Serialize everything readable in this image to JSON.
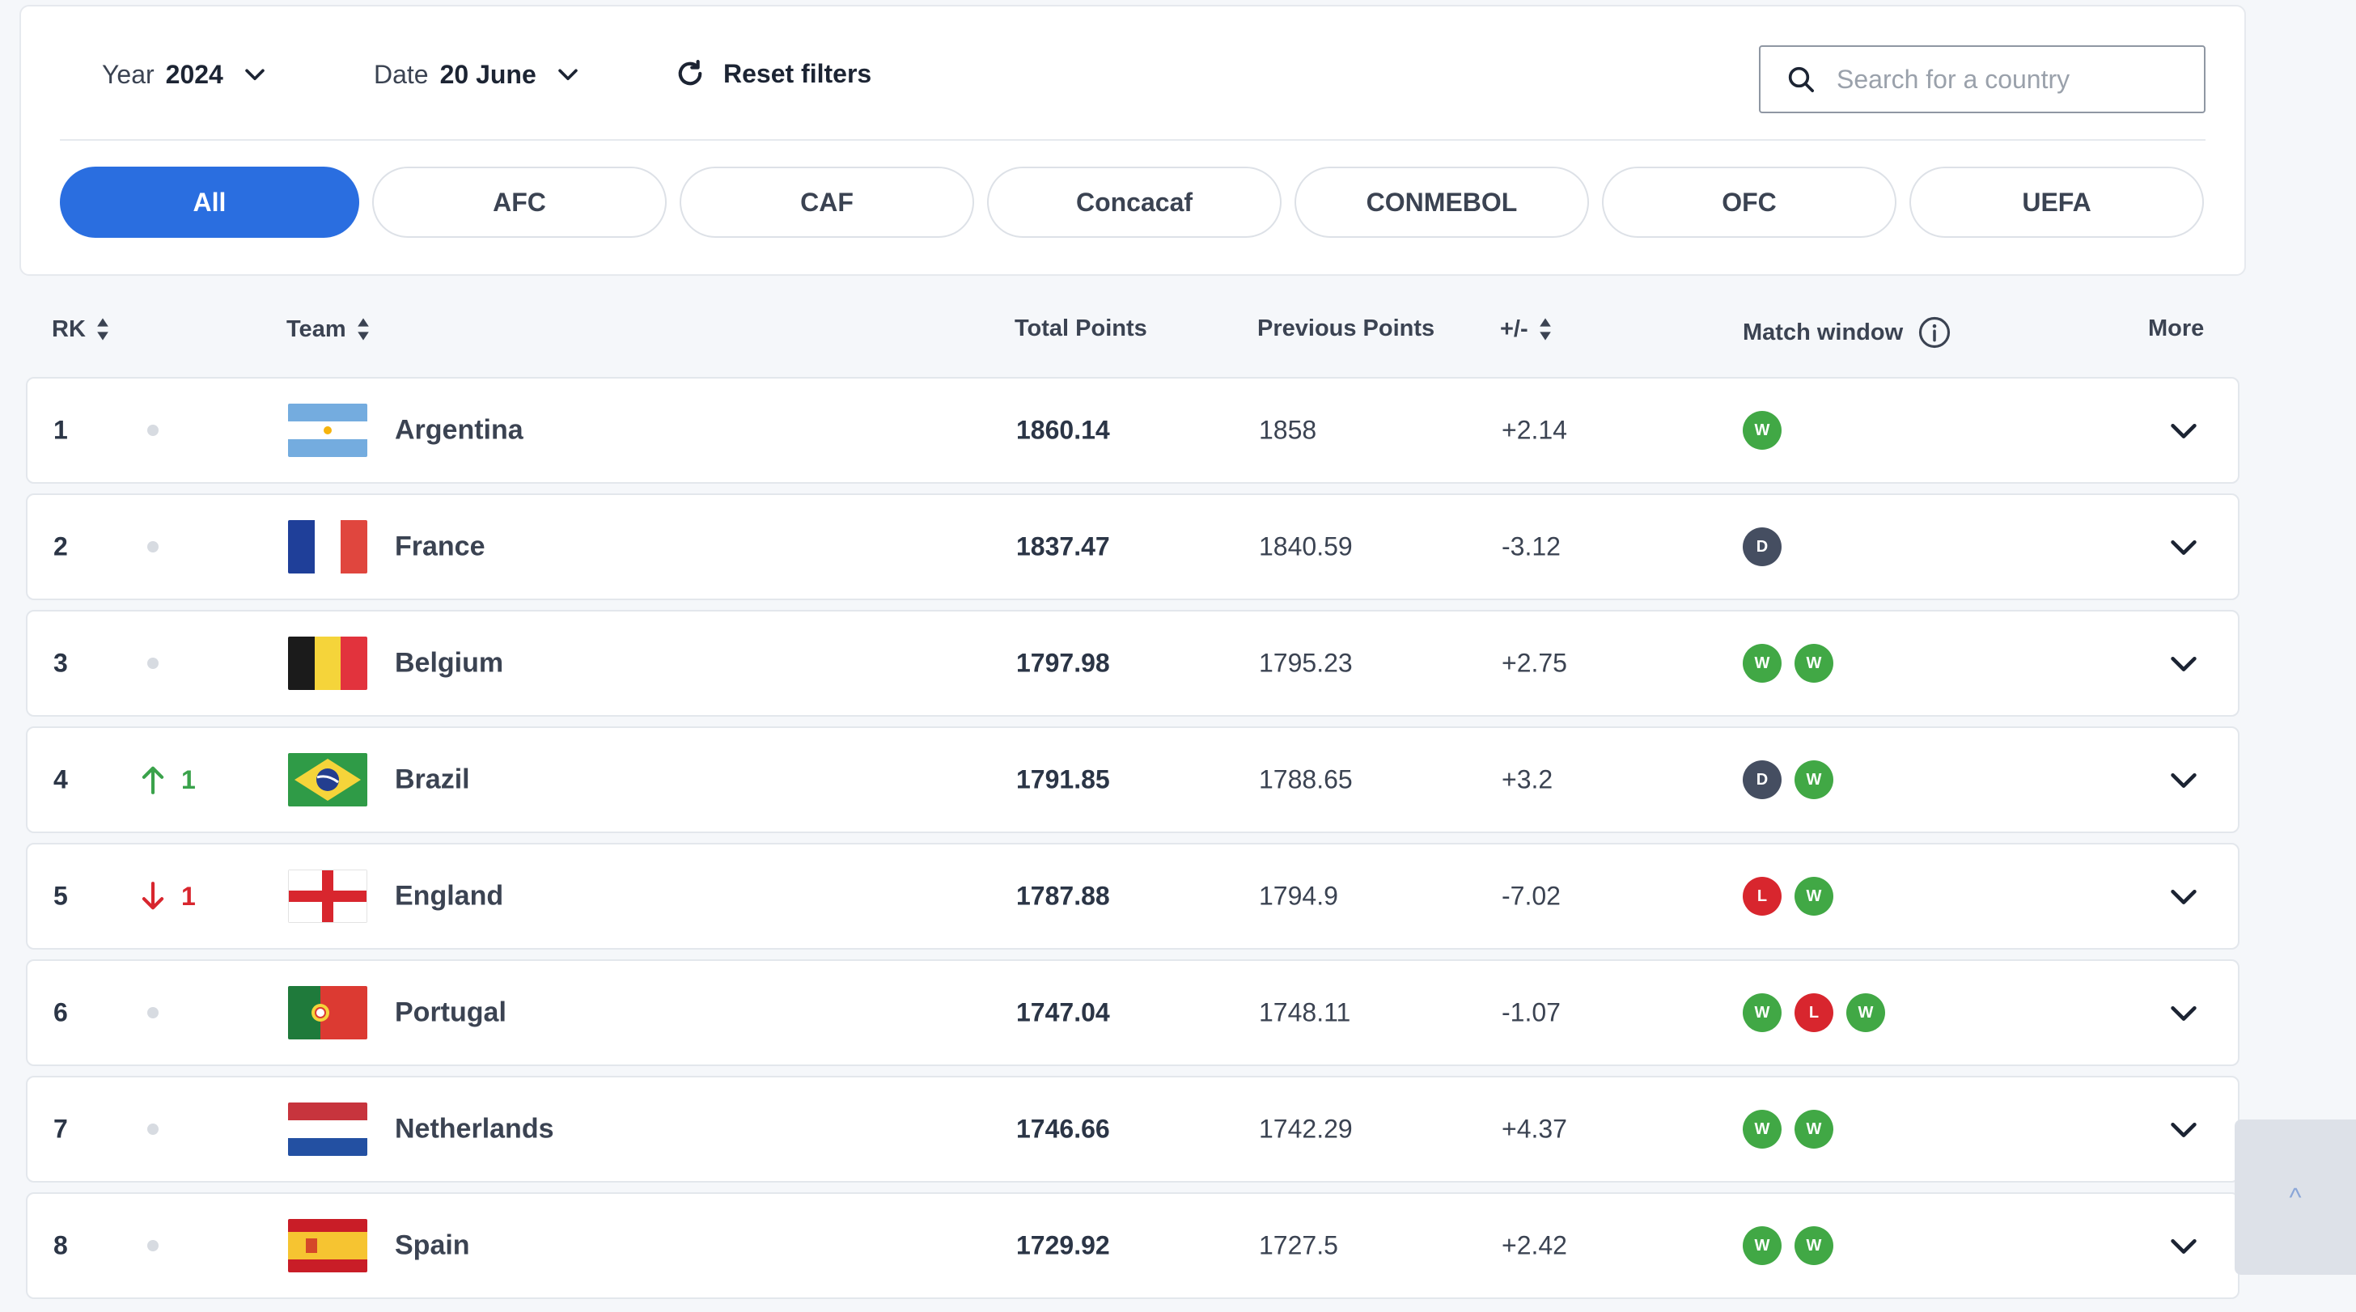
{
  "filters": {
    "year_label": "Year",
    "year_value": "2024",
    "date_label": "Date",
    "date_value": "20 June",
    "reset_label": "Reset filters",
    "search_placeholder": "Search for a country",
    "confederations": [
      "All",
      "AFC",
      "CAF",
      "Concacaf",
      "CONMEBOL",
      "OFC",
      "UEFA"
    ],
    "active_confederation": "All"
  },
  "table": {
    "headers": {
      "rank": "RK",
      "team": "Team",
      "total_points": "Total Points",
      "previous_points": "Previous Points",
      "diff": "+/-",
      "match_window": "Match window",
      "more": "More"
    },
    "rows": [
      {
        "rank": "1",
        "movement": "none",
        "movement_value": "",
        "flag": "argentina",
        "team": "Argentina",
        "total": "1860.14",
        "previous": "1858",
        "diff": "+2.14",
        "results": [
          "W"
        ]
      },
      {
        "rank": "2",
        "movement": "none",
        "movement_value": "",
        "flag": "france",
        "team": "France",
        "total": "1837.47",
        "previous": "1840.59",
        "diff": "-3.12",
        "results": [
          "D"
        ]
      },
      {
        "rank": "3",
        "movement": "none",
        "movement_value": "",
        "flag": "belgium",
        "team": "Belgium",
        "total": "1797.98",
        "previous": "1795.23",
        "diff": "+2.75",
        "results": [
          "W",
          "W"
        ]
      },
      {
        "rank": "4",
        "movement": "up",
        "movement_value": "1",
        "flag": "brazil",
        "team": "Brazil",
        "total": "1791.85",
        "previous": "1788.65",
        "diff": "+3.2",
        "results": [
          "D",
          "W"
        ]
      },
      {
        "rank": "5",
        "movement": "down",
        "movement_value": "1",
        "flag": "england",
        "team": "England",
        "total": "1787.88",
        "previous": "1794.9",
        "diff": "-7.02",
        "results": [
          "L",
          "W"
        ]
      },
      {
        "rank": "6",
        "movement": "none",
        "movement_value": "",
        "flag": "portugal",
        "team": "Portugal",
        "total": "1747.04",
        "previous": "1748.11",
        "diff": "-1.07",
        "results": [
          "W",
          "L",
          "W"
        ]
      },
      {
        "rank": "7",
        "movement": "none",
        "movement_value": "",
        "flag": "netherlands",
        "team": "Netherlands",
        "total": "1746.66",
        "previous": "1742.29",
        "diff": "+4.37",
        "results": [
          "W",
          "W"
        ]
      },
      {
        "rank": "8",
        "movement": "none",
        "movement_value": "",
        "flag": "spain",
        "team": "Spain",
        "total": "1729.92",
        "previous": "1727.5",
        "diff": "+2.42",
        "results": [
          "W",
          "W"
        ]
      }
    ]
  },
  "colors": {
    "accent": "#2a6ee0",
    "win": "#41a845",
    "draw": "#454e61",
    "loss": "#d8262e",
    "up": "#3aa24b",
    "down": "#d8262e"
  },
  "back_to_top_label": "^"
}
